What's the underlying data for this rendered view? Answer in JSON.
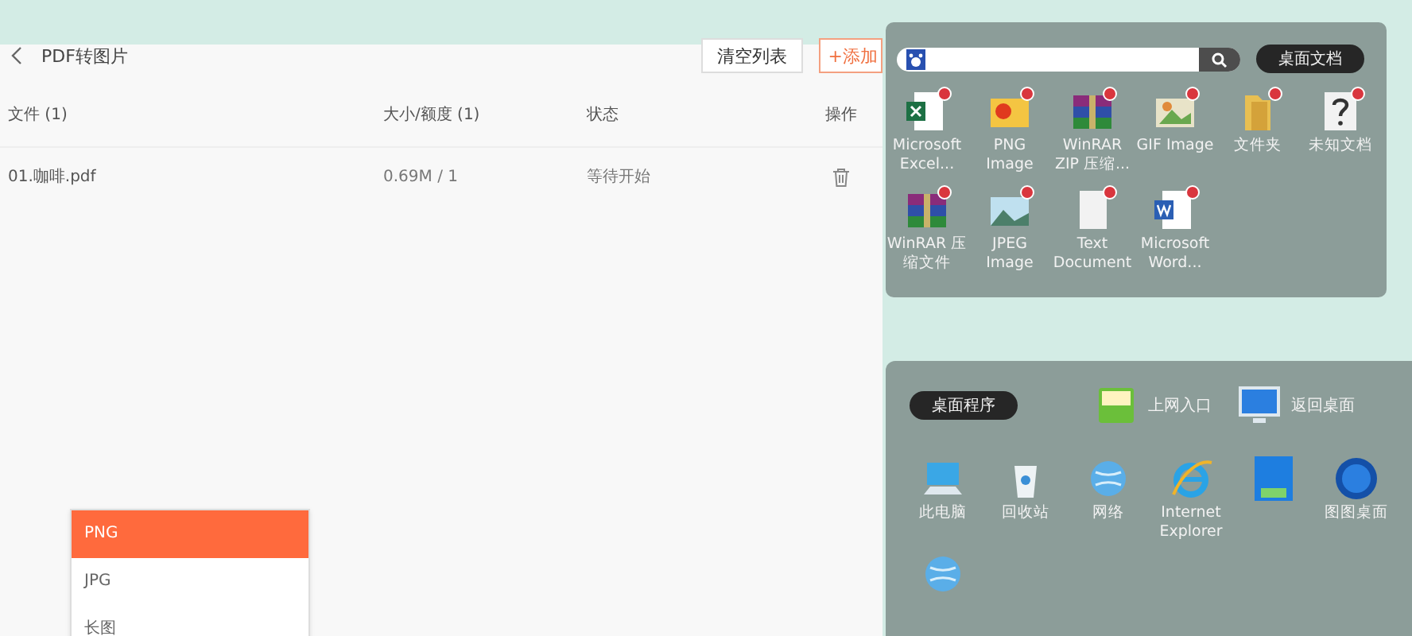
{
  "app": {
    "title": "PDF转图片",
    "buttons": [
      {
        "label": "清空列表",
        "kind": "plain"
      },
      {
        "label": "+添加",
        "kind": "accent"
      }
    ],
    "table": {
      "columns": [
        "文件 (1)",
        "大小/额度 (1)",
        "状态",
        "操作"
      ],
      "rows": [
        {
          "file": "01.咖啡.pdf",
          "size": "0.69M / 1",
          "status": "等待开始"
        }
      ]
    },
    "dropdown": [
      {
        "label": "PNG",
        "selected": true
      },
      {
        "label": "JPG",
        "selected": false
      },
      {
        "label": "长图",
        "selected": false
      }
    ]
  },
  "documents_panel": {
    "button": "桌面文档",
    "icons": [
      {
        "kind": "excel",
        "label": "Microsoft Excel..."
      },
      {
        "kind": "image",
        "label": "PNG Image"
      },
      {
        "kind": "archive",
        "label": "WinRAR ZIP 压缩..."
      },
      {
        "kind": "gif",
        "label": "GIF Image"
      },
      {
        "kind": "folder",
        "label": "文件夹"
      },
      {
        "kind": "unknown",
        "label": "未知文档"
      },
      {
        "kind": "archive",
        "label": "WinRAR 压缩文件"
      },
      {
        "kind": "photo",
        "label": "JPEG Image"
      },
      {
        "kind": "text",
        "label": "Text Document"
      },
      {
        "kind": "word",
        "label": "Microsoft Word..."
      }
    ]
  },
  "programs_panel": {
    "button": "桌面程序",
    "links": [
      {
        "kind": "hao",
        "label": "上网入口"
      },
      {
        "kind": "monitor",
        "label": "返回桌面"
      }
    ],
    "icons": [
      {
        "kind": "computer",
        "label": "此电脑"
      },
      {
        "kind": "recycle",
        "label": "回收站"
      },
      {
        "kind": "network",
        "label": "网络"
      },
      {
        "kind": "ie",
        "label": "Internet Explorer"
      },
      {
        "kind": "app"
      },
      {
        "kind": "fufu",
        "label": "图图桌面"
      },
      {
        "kind": "network"
      }
    ]
  }
}
